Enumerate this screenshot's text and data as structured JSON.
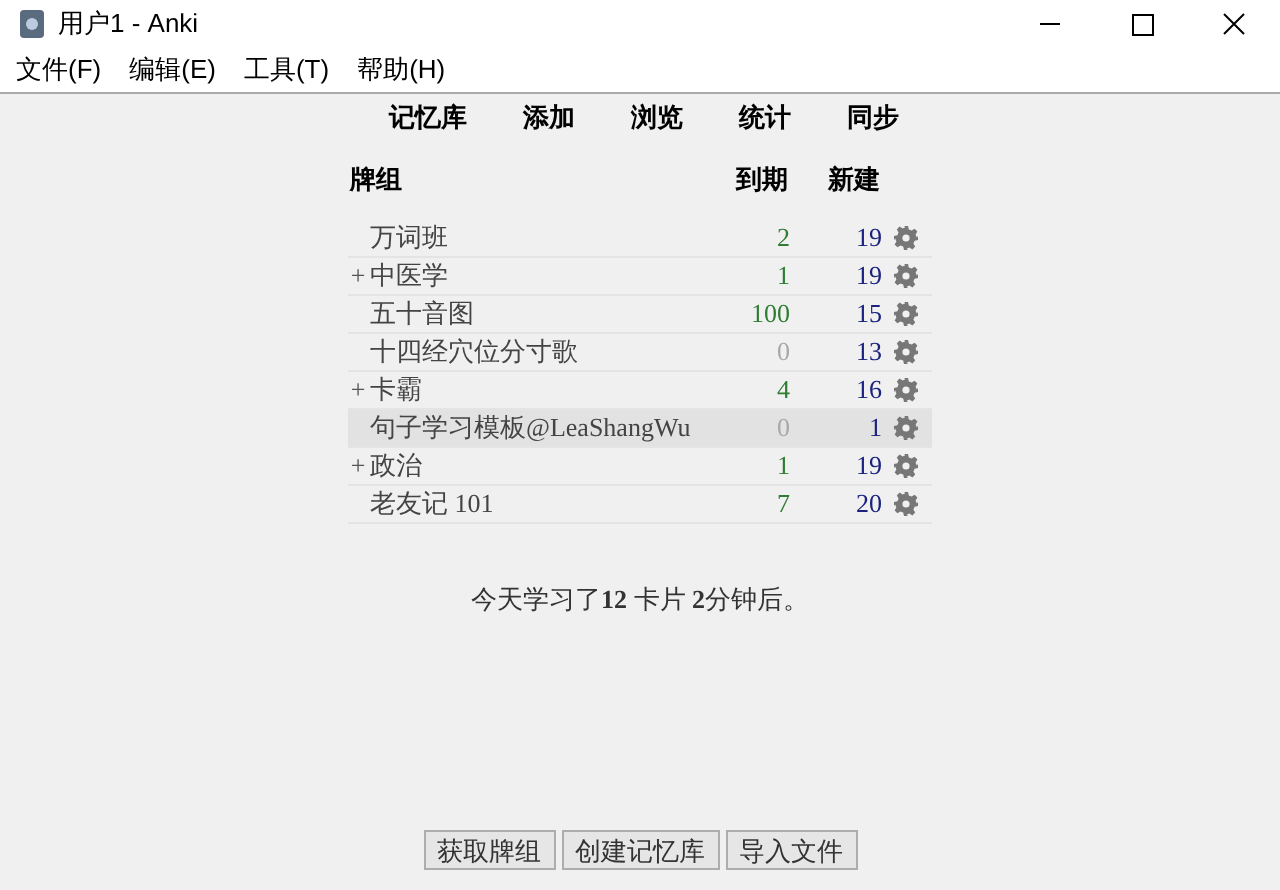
{
  "window": {
    "title": "用户1 - Anki"
  },
  "menu": [
    "文件(F)",
    "编辑(E)",
    "工具(T)",
    "帮助(H)"
  ],
  "toolbar": [
    "记忆库",
    "添加",
    "浏览",
    "统计",
    "同步"
  ],
  "table": {
    "columns": [
      "牌组",
      "到期",
      "新建"
    ],
    "rows": [
      {
        "name": "万词班",
        "due": "2",
        "due_muted": false,
        "new": "19",
        "selected": false
      },
      {
        "name": "中医学",
        "expander": "+",
        "due": "1",
        "due_muted": false,
        "new": "19",
        "selected": false
      },
      {
        "name": "五十音图",
        "due": "100",
        "due_muted": false,
        "new": "15",
        "selected": false
      },
      {
        "name": "十四经穴位分寸歌",
        "due": "0",
        "due_muted": true,
        "new": "13",
        "selected": false
      },
      {
        "name": "卡霸",
        "expander": "+",
        "due": "4",
        "due_muted": false,
        "new": "16",
        "selected": false
      },
      {
        "name": "句子学习模板@LeaShangWu",
        "due": "0",
        "due_muted": true,
        "new": "1",
        "selected": true
      },
      {
        "name": "政治",
        "expander": "+",
        "due": "1",
        "due_muted": false,
        "new": "19",
        "selected": false
      },
      {
        "name": "老友记 101",
        "due": "7",
        "due_muted": false,
        "new": "20",
        "selected": false
      }
    ]
  },
  "summary": "今天学习了**12** 卡片 **2**分钟后。",
  "buttons": [
    "获取牌组",
    "创建记忆库",
    "导入文件"
  ]
}
